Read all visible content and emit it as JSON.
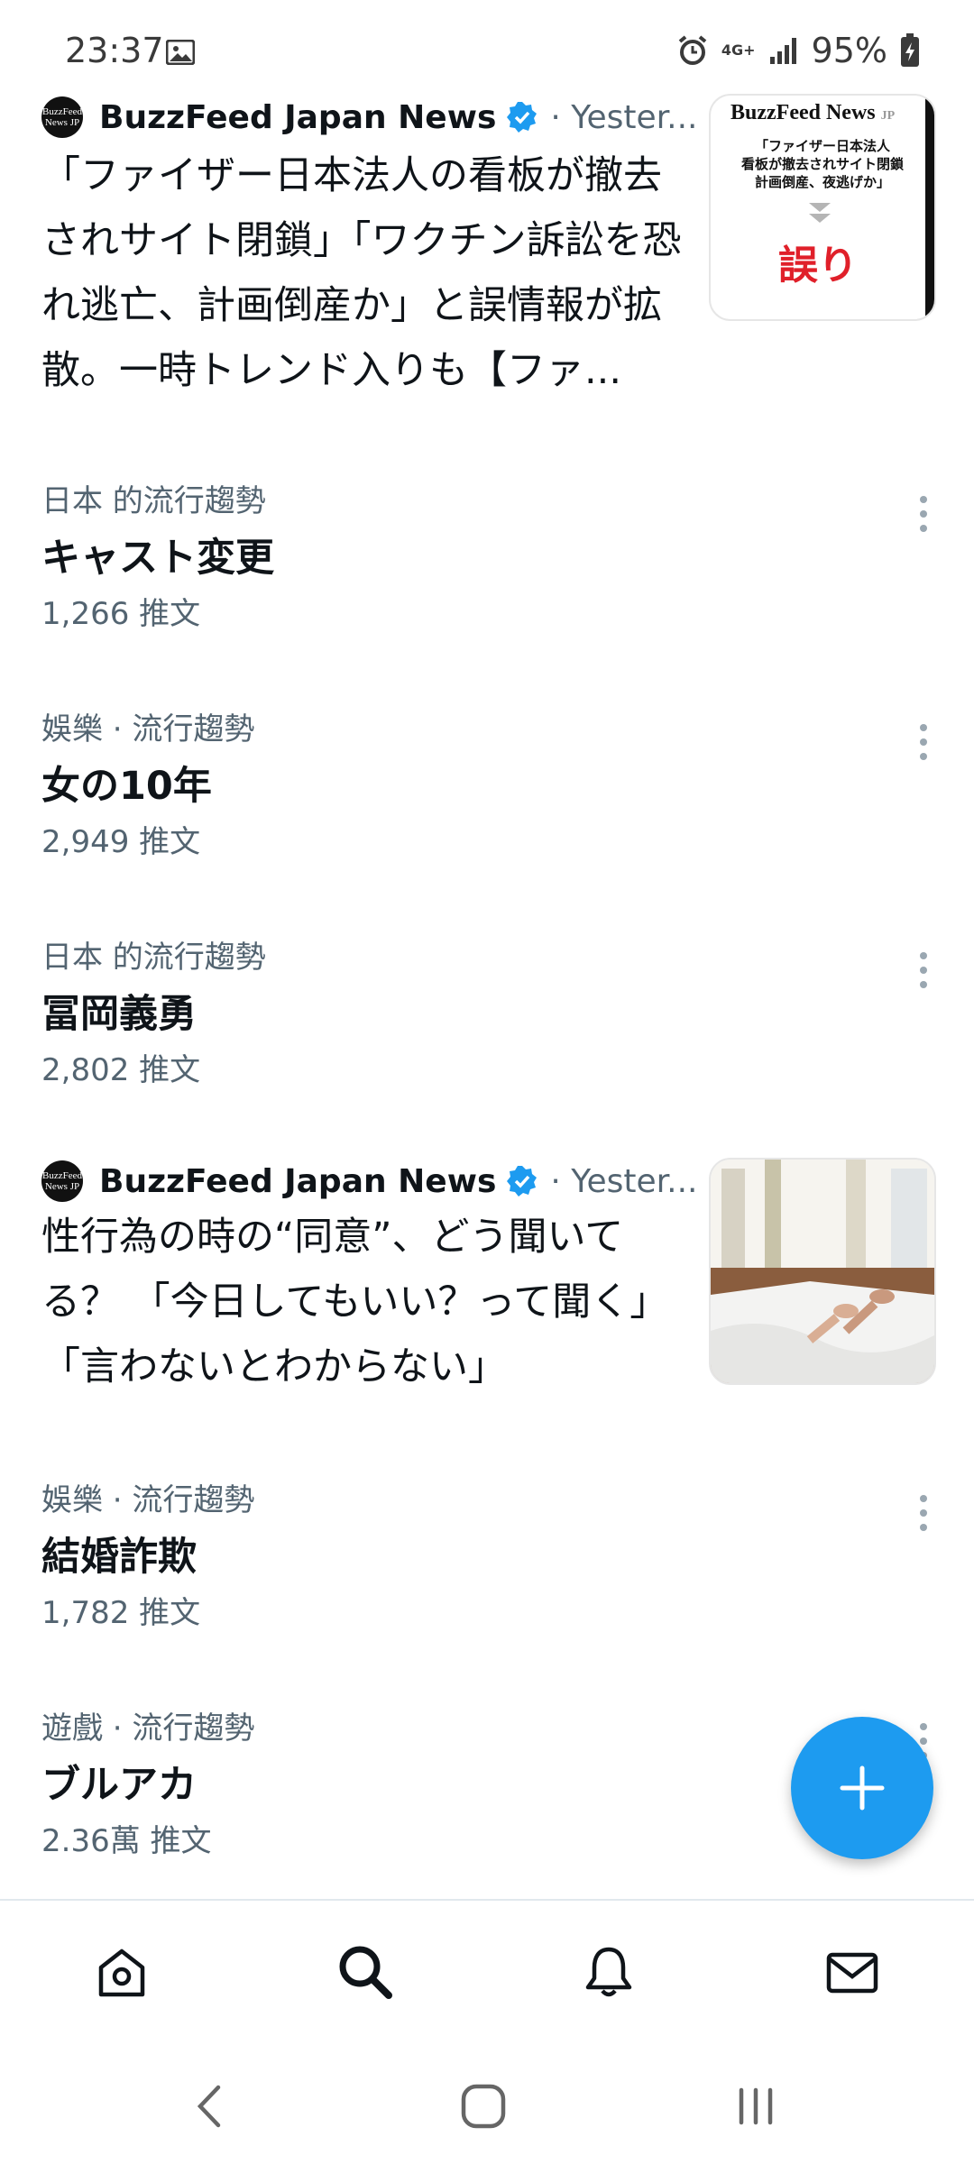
{
  "status_bar": {
    "time": "23:37",
    "network": "4G+",
    "battery": "95%"
  },
  "news": [
    {
      "avatar_text": "BuzzFeed News JP",
      "author": "BuzzFeed Japan News",
      "time": "· Yester...",
      "headline": "「ファイザー日本法人の看板が撤去されサイト閉鎖」「ワクチン訴訟を恐れ逃亡、計画倒産か」と誤情報が拡散。一時トレンド入りも【ファ...",
      "thumbnail": {
        "brand": "BuzzFeed News",
        "brand_suffix": "JP",
        "lines": [
          "「ファイザー日本法人",
          "看板が撤去されサイト閉鎖",
          "計画倒産、夜逃げか」"
        ],
        "verdict": "誤り"
      }
    },
    {
      "avatar_text": "BuzzFeed News JP",
      "author": "BuzzFeed Japan News",
      "time": "· Yester...",
      "headline": "性行為の時の“同意”、どう聞いてる？ 「今日してもいい？って聞く」「言わないとわからない」",
      "thumbnail_icon": "bed-photo"
    }
  ],
  "trends": [
    {
      "category": "日本 的流行趨勢",
      "title": "キャスト変更",
      "count": "1,266 推文"
    },
    {
      "category": "娛樂 · 流行趨勢",
      "title": "女の10年",
      "count": "2,949 推文"
    },
    {
      "category": "日本 的流行趨勢",
      "title": "冨岡義勇",
      "count": "2,802 推文"
    },
    {
      "category": "娛樂 · 流行趨勢",
      "title": "結婚詐欺",
      "count": "1,782 推文"
    },
    {
      "category": "遊戲 · 流行趨勢",
      "title": "ブルアカ",
      "count": "2.36萬 推文"
    }
  ],
  "colors": {
    "accent": "#1d9bf0",
    "text": "#0f1419",
    "secondary": "#536471"
  },
  "bottom_nav": [
    "home-icon",
    "search-icon",
    "bell-icon",
    "mail-icon"
  ],
  "system_nav": [
    "back-icon",
    "home-circle-icon",
    "recents-icon"
  ]
}
